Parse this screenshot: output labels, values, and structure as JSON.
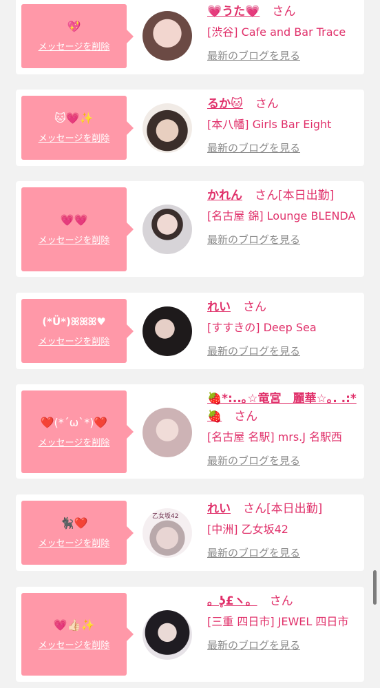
{
  "delete_label": "メッセージを削除",
  "blog_label": "最新のブログを見る",
  "san_label": "さん",
  "cards": [
    {
      "message": "💖",
      "name": "💗うた💗",
      "status": "",
      "shop": "[渋谷] Cafe and Bar Trace",
      "avatar_color": "#d9a9a6"
    },
    {
      "message": "🐱💗✨",
      "name": "るか🐱",
      "status": "",
      "shop": "[本八幡] Girls Bar Eight",
      "avatar_color": "#8c7b70"
    },
    {
      "message": "💗💗",
      "name": "かれん",
      "status": "[本日出勤]",
      "shop": "[名古屋 錦] Lounge BLENDA",
      "avatar_color": "#c9c4c8"
    },
    {
      "message": "(*Ü*)ꕤꕤꕤ♥",
      "name": "れい",
      "status": "",
      "shop": "[すすきの] Deep Sea",
      "avatar_color": "#5b4a48"
    },
    {
      "message": "❤️(*´ω`*)❤️",
      "name": "🍓*:..｡☆竜宮　麗華☆｡. .:*🍓",
      "status": "",
      "shop": "[名古屋 名駅] mrs.J 名駅西",
      "avatar_color": "#d8c2c4"
    },
    {
      "message": "🐈‍⬛❤️",
      "name": "れい",
      "status": "[本日出勤]",
      "shop": "[中洲] 乙女坂42",
      "avatar_color": "#e4d8dc",
      "avatar_text": "乙女坂42"
    },
    {
      "message": "💗👍🏻✨",
      "name": "。ʖ̥£ヽ。",
      "status": "",
      "shop": "[三重 四日市] JEWEL 四日市",
      "avatar_color": "#3d3a42"
    }
  ]
}
